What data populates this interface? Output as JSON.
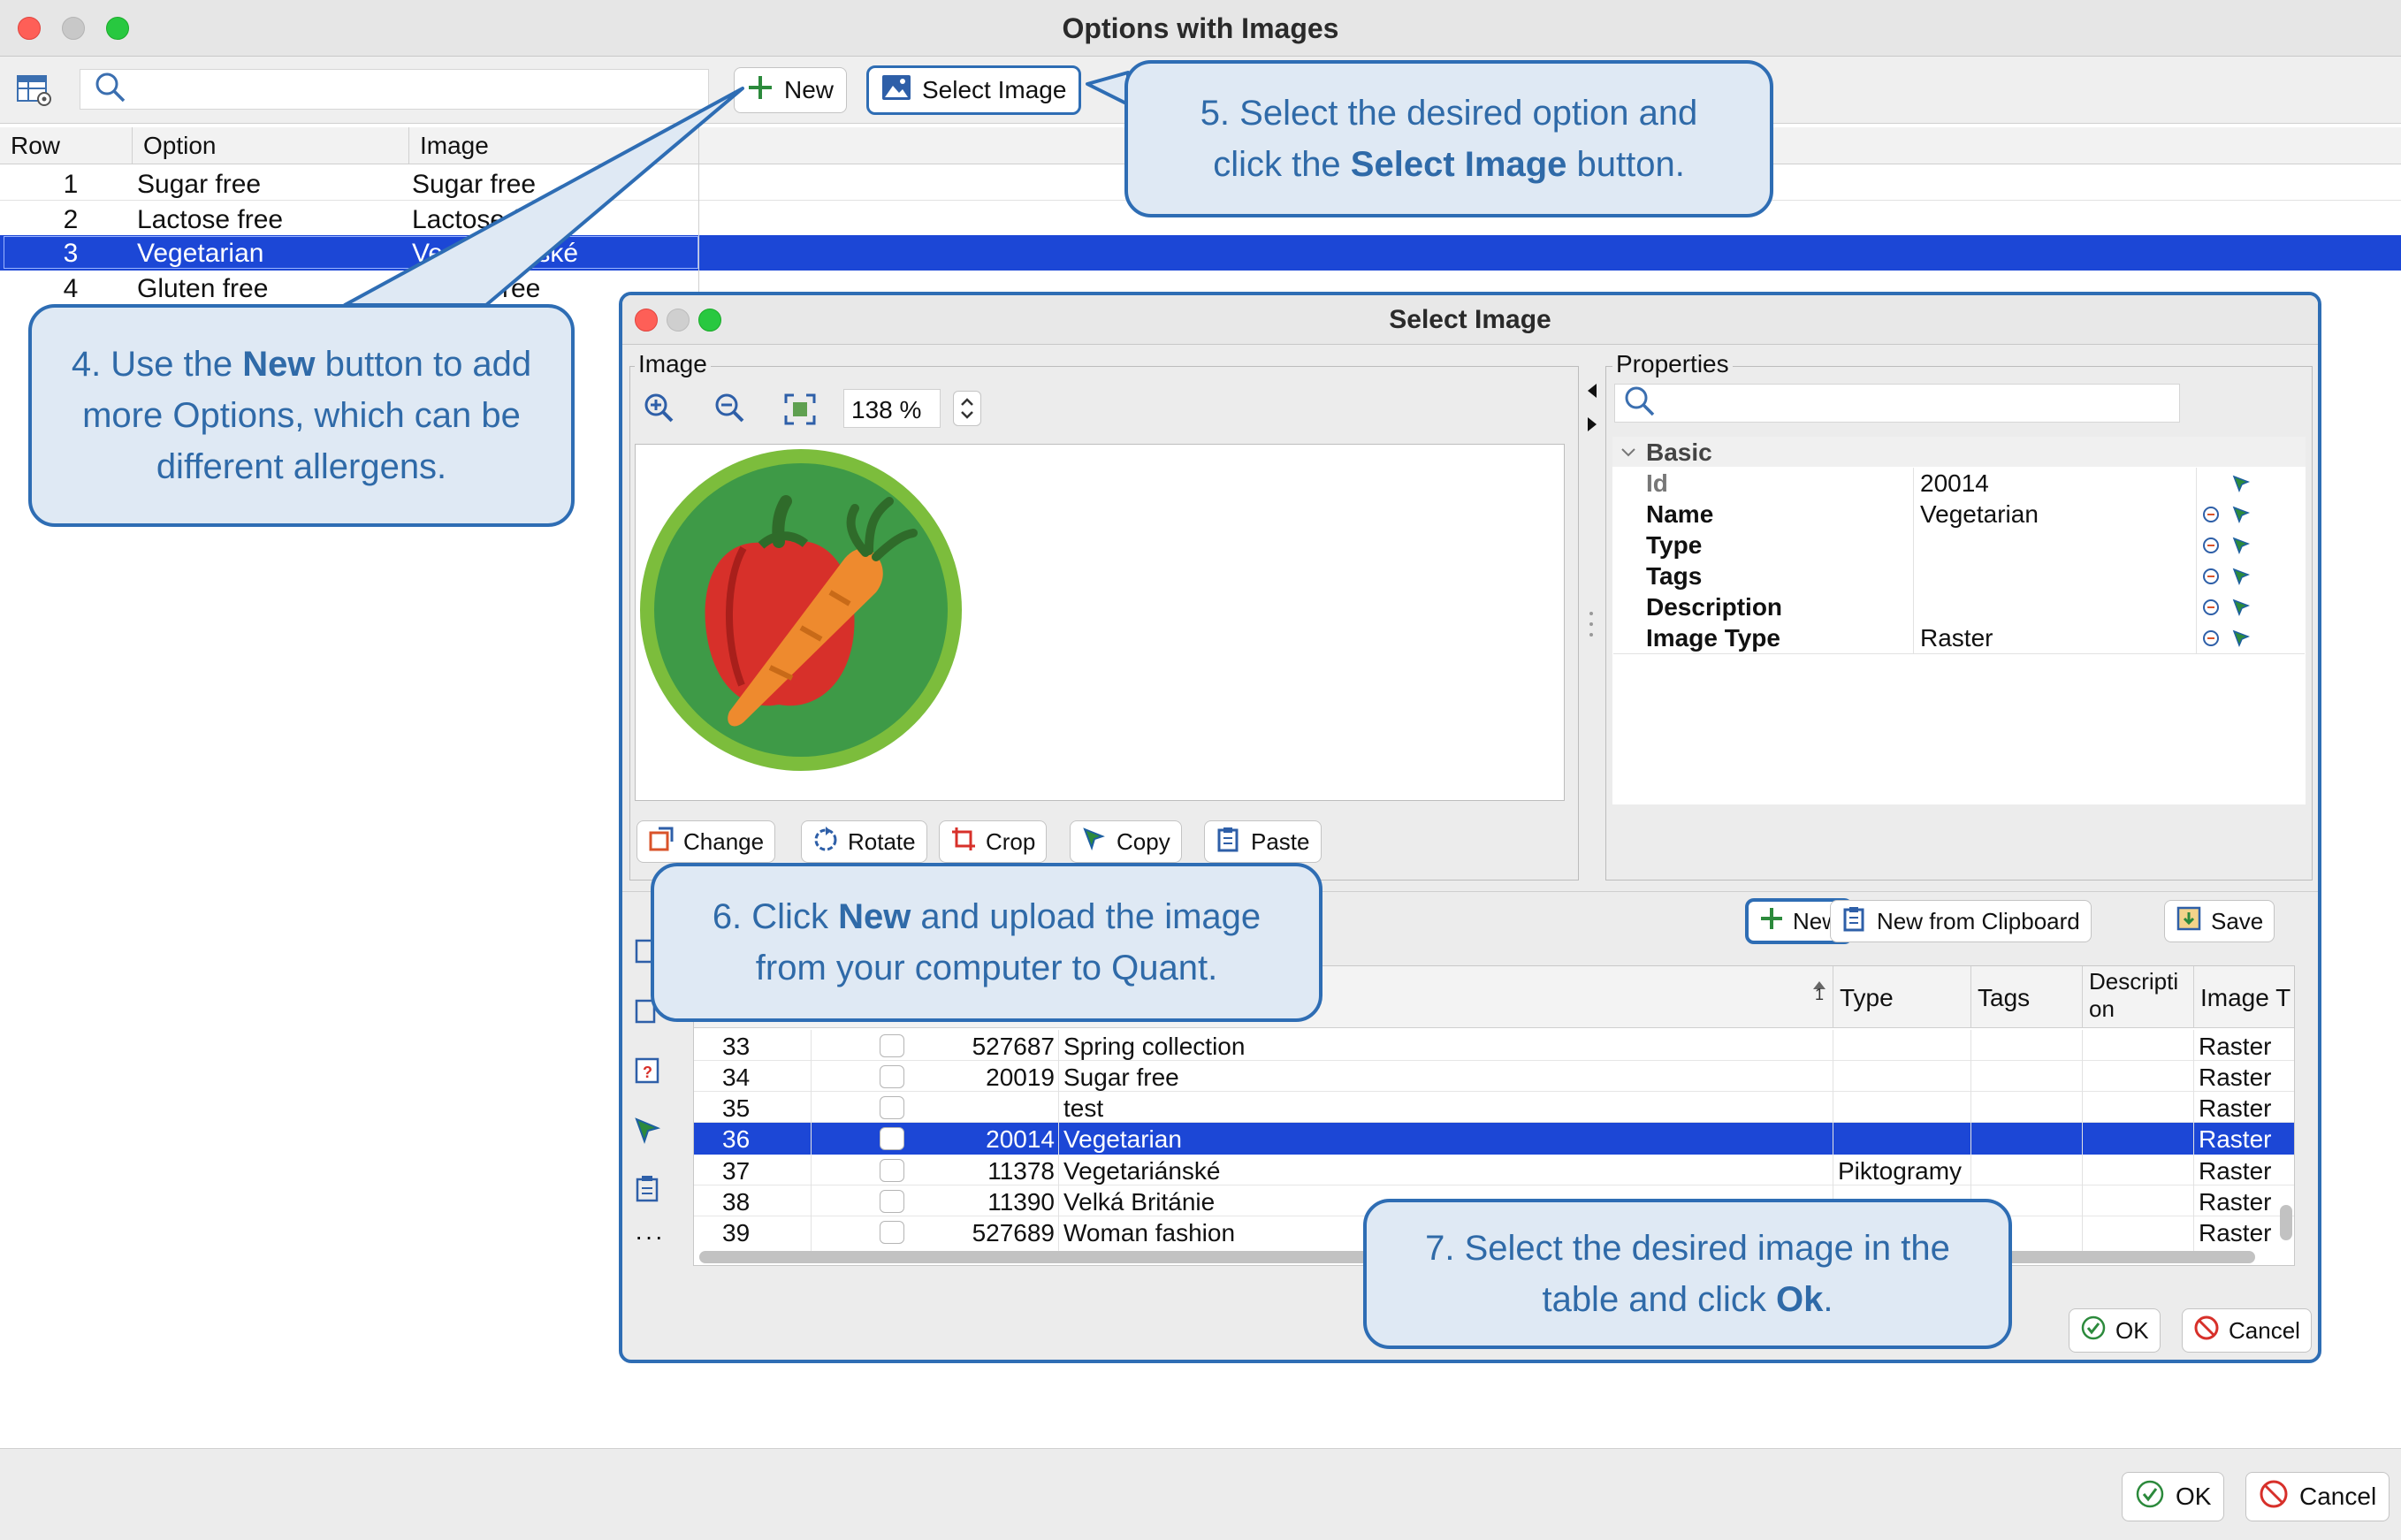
{
  "window": {
    "title": "Options with Images"
  },
  "toolbar": {
    "search_placeholder": "",
    "new_label": "New",
    "select_image_label": "Select Image"
  },
  "options_table": {
    "columns": [
      "Row",
      "Option",
      "Image"
    ],
    "rows": [
      {
        "row": "1",
        "option": "Sugar free",
        "image": "Sugar free"
      },
      {
        "row": "2",
        "option": "Lactose free",
        "image": "Lactose f"
      },
      {
        "row": "3",
        "option": "Vegetarian",
        "image": "Ve",
        "image_tail": "ánské"
      },
      {
        "row": "4",
        "option": "Gluten free",
        "image": "ree"
      }
    ],
    "selected_row": 3
  },
  "callouts": {
    "c4": {
      "pre": "4. Use the ",
      "bold": "New",
      "post": " button to add more Options, which can be different allergens."
    },
    "c5": {
      "pre": "5. Select the desired option and click the ",
      "bold": "Select Image",
      "post": " button."
    },
    "c6": {
      "pre": "6. Click ",
      "bold": "New",
      "post": " and upload the image from your computer to Quant."
    },
    "c7": {
      "pre": "7. Select the desired image in the table and click ",
      "bold": "Ok",
      "post": "."
    }
  },
  "dialog": {
    "title": "Select Image",
    "image_panel": {
      "title": "Image",
      "zoom": "138 %",
      "buttons": [
        "Change",
        "Rotate",
        "Crop",
        "Copy",
        "Paste"
      ]
    },
    "properties": {
      "title": "Properties",
      "search_placeholder": "",
      "group": "Basic",
      "rows": [
        {
          "key": "Id",
          "value": "20014"
        },
        {
          "key": "Name",
          "value": "Vegetarian"
        },
        {
          "key": "Type",
          "value": ""
        },
        {
          "key": "Tags",
          "value": ""
        },
        {
          "key": "Description",
          "value": ""
        },
        {
          "key": "Image Type",
          "value": "Raster"
        }
      ]
    },
    "lower_toolbar": {
      "new_label": "New",
      "new_from_clipboard_label": "New from Clipboard",
      "save_label": "Save"
    },
    "images_table": {
      "columns": [
        "Type",
        "Tags",
        "Descripti on",
        "Image T"
      ],
      "sort_indicator": "1",
      "rows": [
        {
          "row": "33",
          "id": "527687",
          "name": "Spring collection",
          "type": "",
          "image_type": "Raster"
        },
        {
          "row": "34",
          "id": "20019",
          "name": "Sugar free",
          "type": "",
          "image_type": "Raster"
        },
        {
          "row": "35",
          "id": "",
          "name": "test",
          "type": "",
          "image_type": "Raster"
        },
        {
          "row": "36",
          "id": "20014",
          "name": "Vegetarian",
          "type": "",
          "image_type": "Raster"
        },
        {
          "row": "37",
          "id": "11378",
          "name": "Vegetariánské",
          "type": "Piktogramy",
          "image_type": "Raster"
        },
        {
          "row": "38",
          "id": "11390",
          "name": "Velká Británie",
          "type": "",
          "image_type": "Raster"
        },
        {
          "row": "39",
          "id": "527689",
          "name": "Woman fashion",
          "type": "",
          "image_type": "Raster"
        }
      ],
      "selected_row": "36"
    },
    "ok_label": "OK",
    "cancel_label": "Cancel"
  },
  "footer": {
    "ok_label": "OK",
    "cancel_label": "Cancel"
  },
  "colors": {
    "selection": "#1c47d6",
    "callout_border": "#2e6db4",
    "callout_fill": "#dfe9f4",
    "callout_text": "#2f6aa8"
  }
}
